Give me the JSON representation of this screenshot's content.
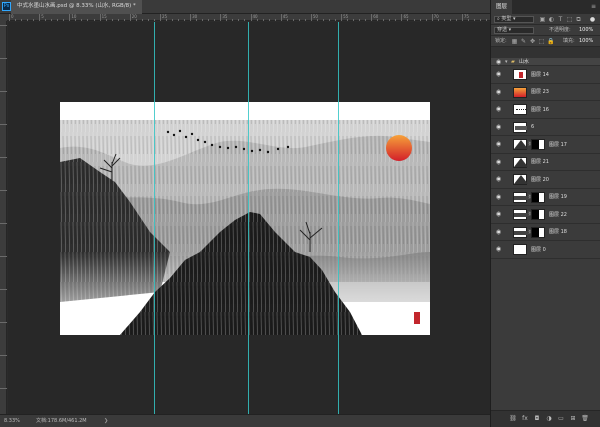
{
  "document": {
    "tab_title": "中式水墨山水画.psd @ 8.33% (山水, RGB/8) *",
    "zoom": "8.33%",
    "doc_size": "文档:178.6M/461.2M"
  },
  "ruler": {
    "labels": [
      "0",
      "5",
      "10",
      "15",
      "20",
      "25",
      "30",
      "35",
      "40",
      "45",
      "50",
      "55",
      "60",
      "65",
      "70",
      "75"
    ]
  },
  "colors": {
    "guide": "#34c6c6",
    "sun_top": "#f6a23a",
    "sun_bottom": "#d3202a",
    "seal": "#c2262c",
    "canvas_bg": "#282828"
  },
  "panel": {
    "tab": "图层",
    "filter_label": "类型",
    "blend_mode": "穿透",
    "opacity_label": "不透明度:",
    "opacity_value": "100%",
    "lock_label": "锁定:",
    "fill_label": "填充:",
    "fill_value": "100%",
    "group_name": "山水",
    "layers": [
      {
        "name": "图层 14",
        "thumb": "seal",
        "mask": false
      },
      {
        "name": "图层 23",
        "thumb": "sunglow",
        "mask": false
      },
      {
        "name": "图层 16",
        "thumb": "birds",
        "mask": false
      },
      {
        "name": "6",
        "thumb": "tree",
        "mask": false
      },
      {
        "name": "图层 17",
        "thumb": "mountain",
        "mask": true
      },
      {
        "name": "图层 21",
        "thumb": "mountain",
        "mask": false
      },
      {
        "name": "图层 20",
        "thumb": "mountain",
        "mask": false
      },
      {
        "name": "图层 19",
        "thumb": "strip",
        "mask": true
      },
      {
        "name": "图层 22",
        "thumb": "strip",
        "mask": true
      },
      {
        "name": "图层 18",
        "thumb": "strip",
        "mask": true
      },
      {
        "name": "图层 0",
        "thumb": "white",
        "mask": false
      }
    ]
  }
}
